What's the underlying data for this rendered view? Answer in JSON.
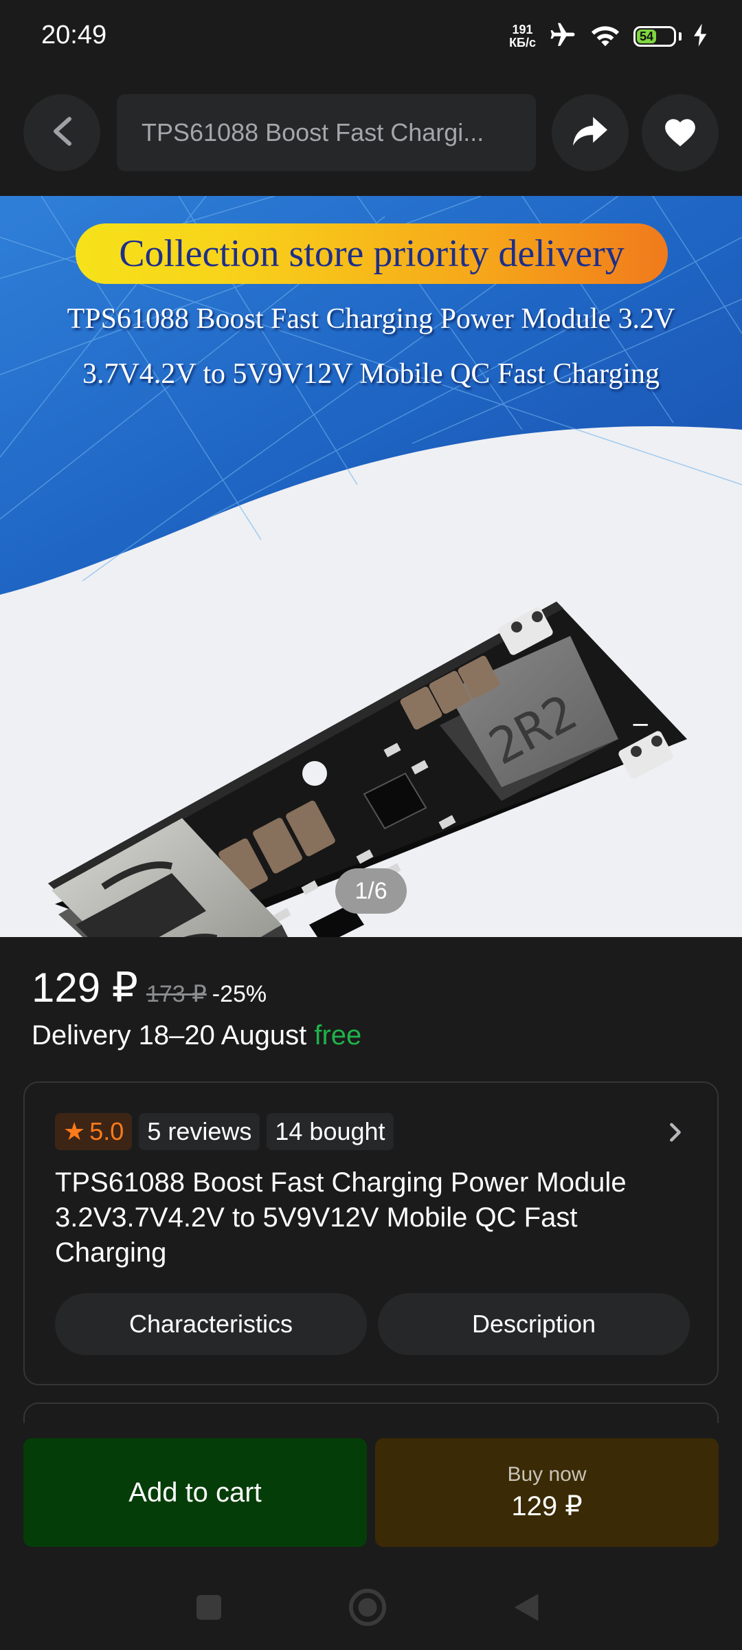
{
  "status_bar": {
    "time": "20:49",
    "net_speed_value": "191",
    "net_speed_unit": "КБ/с",
    "battery_level": "54"
  },
  "top_bar": {
    "search_text": "TPS61088 Boost Fast Chargi..."
  },
  "gallery": {
    "promo_text": "Collection store priority delivery",
    "banner_line1": "TPS61088 Boost Fast Charging Power Module 3.2V",
    "banner_line2": "3.7V4.2V to 5V9V12V Mobile QC Fast Charging",
    "page_counter": "1/6"
  },
  "price": {
    "current": "129 ₽",
    "old": "173 ₽",
    "discount": "-25%"
  },
  "delivery": {
    "text": "Delivery 18–20 August ",
    "free_label": "free"
  },
  "info_card": {
    "rating": "5.0",
    "reviews": "5 reviews",
    "bought": "14 bought",
    "title": "TPS61088 Boost Fast Charging Power Module 3.2V3.7V4.2V to 5V9V12V Mobile QC Fast Charging",
    "characteristics_label": "Characteristics",
    "description_label": "Description"
  },
  "actions": {
    "add_to_cart_label": "Add to cart",
    "buy_now_label": "Buy now",
    "buy_now_price": "129 ₽"
  },
  "colors": {
    "background": "#1b1b1b",
    "surface": "#262728",
    "free_green": "#1fb34a",
    "rating_orange": "#ff7a1a",
    "cart_button": "#053d08",
    "buy_button": "#3a2a05"
  }
}
